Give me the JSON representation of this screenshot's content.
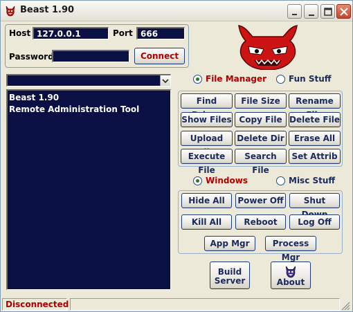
{
  "window": {
    "title": "Beast 1.90"
  },
  "connection": {
    "host_label": "Host",
    "host_value": "127.0.0.1",
    "port_label": "Port",
    "port_value": "666",
    "password_label": "Password",
    "password_value": "",
    "connect_label": "Connect"
  },
  "output": {
    "lines": [
      "Beast 1.90",
      "Remote Administration Tool"
    ]
  },
  "file_section": {
    "radio_file_manager": "File Manager",
    "radio_fun_stuff": "Fun Stuff",
    "buttons": [
      "Find Drives",
      "File Size",
      "Rename File",
      "Show Files",
      "Copy File",
      "Delete File",
      "Upload File",
      "Delete Dir",
      "Erase All",
      "Execute File",
      "Search File",
      "Set Attrib"
    ]
  },
  "windows_section": {
    "radio_windows": "Windows",
    "radio_misc_stuff": "Misc Stuff",
    "buttons": [
      "Hide All",
      "Power Off",
      "Shut Down",
      "Kill All",
      "Reboot",
      "Log Off",
      "App Mgr",
      "Process Mgr"
    ]
  },
  "bottom": {
    "build_server_line1": "Build",
    "build_server_line2": "Server",
    "about_label": "About"
  },
  "status": {
    "text": "Disconnected"
  },
  "colors": {
    "field_bg": "#0a1044",
    "accent_red": "#b00000",
    "button_text": "#1b2a5c",
    "window_bg": "#ece9d8"
  },
  "icons": [
    "devil-icon",
    "minimize-icon",
    "maximize-icon",
    "close-icon",
    "dropdown-arrow-icon",
    "resize-grip-icon"
  ]
}
